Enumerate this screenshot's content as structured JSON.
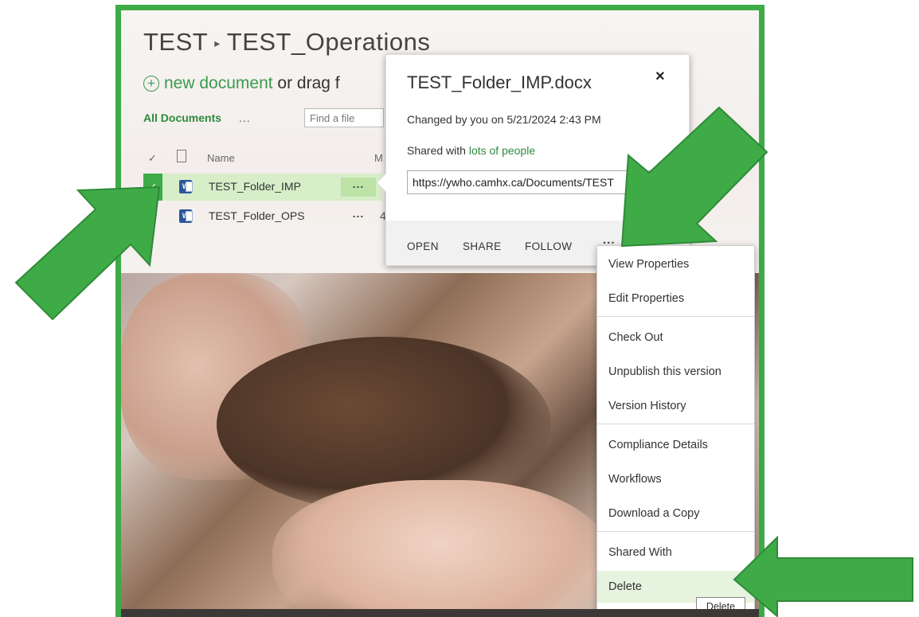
{
  "breadcrumb": {
    "site": "TEST",
    "library": "TEST_Operations",
    "separator": "▸"
  },
  "toolbar": {
    "new_icon": "+",
    "new_link": "new document",
    "drag_text": " or drag f"
  },
  "views": {
    "all_documents": "All Documents",
    "more": "...",
    "search_placeholder": "Find a file"
  },
  "columns": {
    "check": "✓",
    "name": "Name",
    "modified_initial": "M"
  },
  "rows": [
    {
      "name": "TEST_Folder_IMP",
      "more": "...",
      "selected": true,
      "check": "✓",
      "icon": "word-icon"
    },
    {
      "name": "TEST_Folder_OPS",
      "more": "...",
      "selected": false,
      "extra": "4",
      "icon": "word-icon"
    }
  ],
  "callout": {
    "title": "TEST_Folder_IMP.docx",
    "close": "×",
    "changed": "Changed by you on 5/21/2024 2:43 PM",
    "shared_prefix": "Shared with ",
    "shared_link": "lots of people",
    "url": "https://ywho.camhx.ca/Documents/TEST",
    "actions": [
      "OPEN",
      "SHARE",
      "FOLLOW"
    ],
    "more": "..."
  },
  "menu": {
    "items": [
      "View Properties",
      "Edit Properties",
      "Check Out",
      "Unpublish this version",
      "Version History",
      "Compliance Details",
      "Workflows",
      "Download a Copy",
      "Shared With",
      "Delete"
    ],
    "hovered": "Delete"
  },
  "tooltip": "Delete",
  "colors": {
    "frame_green": "#3eab47",
    "accent_green": "#2e8b3e",
    "arrow_green": "#3eab47",
    "row_select": "#d7eec9"
  }
}
